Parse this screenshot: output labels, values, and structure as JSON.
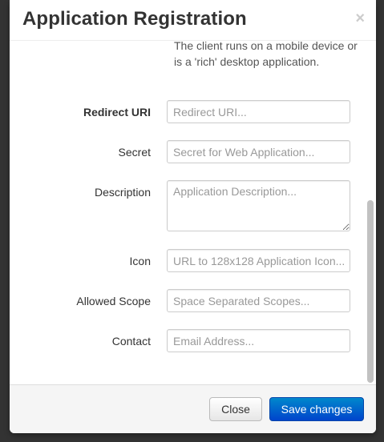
{
  "modal": {
    "title": "Application Registration",
    "close_glyph": "×"
  },
  "help": {
    "client_type_text": "The client runs on a mobile device or is a 'rich' desktop application."
  },
  "form": {
    "redirect_uri": {
      "label": "Redirect URI",
      "value": "",
      "placeholder": "Redirect URI..."
    },
    "secret": {
      "label": "Secret",
      "value": "",
      "placeholder": "Secret for Web Application..."
    },
    "description": {
      "label": "Description",
      "value": "",
      "placeholder": "Application Description..."
    },
    "icon": {
      "label": "Icon",
      "value": "",
      "placeholder": "URL to 128x128 Application Icon..."
    },
    "allowed_scope": {
      "label": "Allowed Scope",
      "value": "",
      "placeholder": "Space Separated Scopes..."
    },
    "contact": {
      "label": "Contact",
      "value": "",
      "placeholder": "Email Address..."
    }
  },
  "footer": {
    "close_label": "Close",
    "save_label": "Save changes"
  },
  "colors": {
    "primary": "#0055cc",
    "backdrop": "#333333"
  }
}
